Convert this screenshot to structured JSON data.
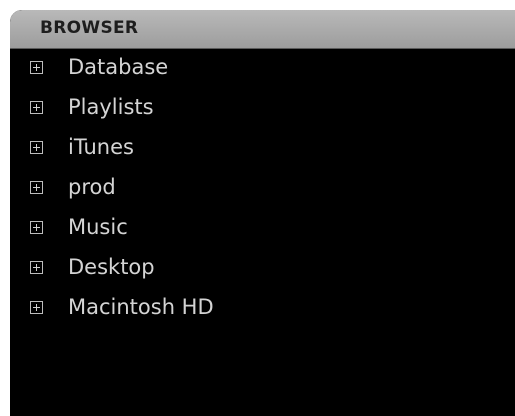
{
  "browser": {
    "title": "BROWSER",
    "items": [
      {
        "label": "Database",
        "icon": "expand-plus-icon"
      },
      {
        "label": "Playlists",
        "icon": "expand-plus-icon"
      },
      {
        "label": "iTunes",
        "icon": "expand-plus-icon"
      },
      {
        "label": "prod",
        "icon": "expand-plus-icon"
      },
      {
        "label": "Music",
        "icon": "expand-plus-icon"
      },
      {
        "label": "Desktop",
        "icon": "expand-plus-icon"
      },
      {
        "label": "Macintosh HD",
        "icon": "expand-plus-icon"
      }
    ]
  },
  "colors": {
    "background": "#000000",
    "header": "#a8a8a8",
    "text": "#d4d4d4"
  }
}
